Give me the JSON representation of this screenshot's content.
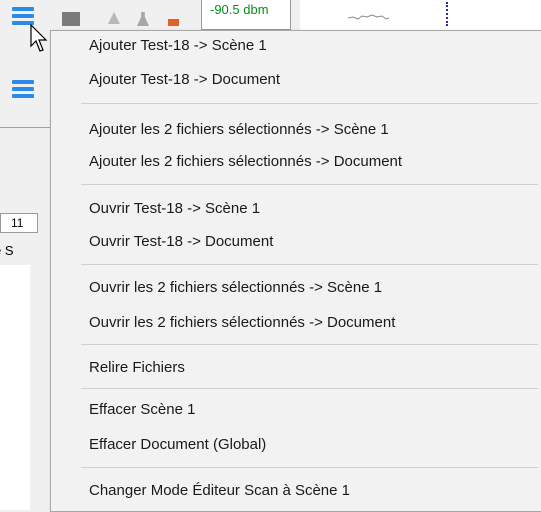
{
  "toolbar": {
    "menu_icon": "hamburger-icon",
    "level_readout": "-90.5 dbm",
    "colors": {
      "accent": "#2b8be6",
      "level_text": "#0a8a1a",
      "marker": "#e0622a"
    }
  },
  "side_panel": {
    "tab_label": "11",
    "scene_fragment": "e S"
  },
  "context_menu": {
    "items": [
      {
        "label": "Ajouter Test-18 -> Scène 1"
      },
      {
        "label": "Ajouter Test-18 -> Document"
      },
      {
        "label": "Ajouter les 2 fichiers sélectionnés -> Scène 1"
      },
      {
        "label": "Ajouter les 2 fichiers sélectionnés -> Document"
      },
      {
        "label": "Ouvrir Test-18 -> Scène 1"
      },
      {
        "label": "Ouvrir Test-18 -> Document"
      },
      {
        "label": "Ouvrir les 2 fichiers sélectionnés -> Scène 1"
      },
      {
        "label": "Ouvrir les 2 fichiers sélectionnés -> Document"
      },
      {
        "label": "Relire Fichiers"
      },
      {
        "label": "Effacer Scène 1"
      },
      {
        "label": "Effacer Document (Global)"
      },
      {
        "label": "Changer Mode Éditeur Scan à Scène 1"
      }
    ]
  },
  "cursor": {
    "icon": "mouse-pointer-icon"
  }
}
